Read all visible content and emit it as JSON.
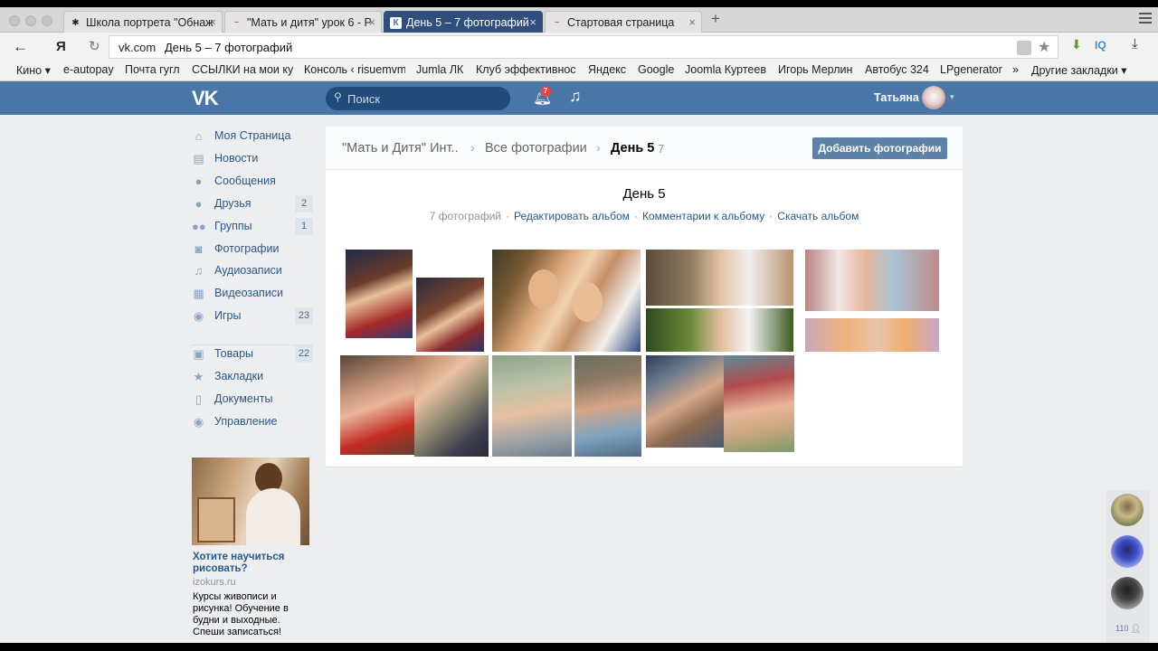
{
  "browser": {
    "tabs": [
      {
        "title": "Школа портрета \"Обнаж",
        "active": false
      },
      {
        "title": "\"Мать и дитя\" урок 6 - Р",
        "active": false
      },
      {
        "title": "День 5 – 7 фотографий",
        "active": true
      },
      {
        "title": "Стартовая страница",
        "active": false
      }
    ],
    "address": {
      "host": "vk.com",
      "title": "День 5 – 7 фотографий"
    },
    "ext_iq": "IQ",
    "bookmarks": [
      "Кино",
      "e-autopay",
      "Почта гугл",
      "ССЫЛКИ на мои ку",
      "Консоль ‹ risuemvm",
      "Jumla ЛК",
      "Клуб эффективнос",
      "Яндекс",
      "Google",
      "Joomla Куртеев",
      "Игорь Мерлин",
      "Автобус 324",
      "LPgenerator",
      "»",
      "Другие закладки"
    ]
  },
  "vk": {
    "logo": "VK",
    "search_placeholder": "Поиск",
    "notif_count": "7",
    "user_name": "Татьяна"
  },
  "sidebar": {
    "items": [
      {
        "label": "Моя Страница",
        "icon": "home-icon",
        "count": ""
      },
      {
        "label": "Новости",
        "icon": "news-icon",
        "count": ""
      },
      {
        "label": "Сообщения",
        "icon": "messages-icon",
        "count": ""
      },
      {
        "label": "Друзья",
        "icon": "friends-icon",
        "count": "2"
      },
      {
        "label": "Группы",
        "icon": "groups-icon",
        "count": "1"
      },
      {
        "label": "Фотографии",
        "icon": "camera-icon",
        "count": ""
      },
      {
        "label": "Аудиозаписи",
        "icon": "music-icon",
        "count": ""
      },
      {
        "label": "Видеозаписи",
        "icon": "video-icon",
        "count": ""
      },
      {
        "label": "Игры",
        "icon": "games-icon",
        "count": "23"
      },
      {
        "label": "Товары",
        "icon": "market-icon",
        "count": "22"
      },
      {
        "label": "Закладки",
        "icon": "star-icon",
        "count": ""
      },
      {
        "label": "Документы",
        "icon": "document-icon",
        "count": ""
      },
      {
        "label": "Управление",
        "icon": "gamepad-icon",
        "count": ""
      }
    ]
  },
  "ad": {
    "title": "Хотите научиться рисовать?",
    "domain": "izokurs.ru",
    "text": "Курсы живописи и рисунка! Обучение в будни и выходные. Спеши записаться!"
  },
  "album": {
    "crumbs": [
      "\"Мать и Дитя\" Инт..",
      "Все фотографии"
    ],
    "current": "День 5",
    "count": "7",
    "add_button": "Добавить фотографии",
    "title": "День 5",
    "photo_count_text": "7 фотографий",
    "actions": [
      "Редактировать альбом",
      "Комментарии к альбому",
      "Скачать альбом"
    ]
  },
  "chat": {
    "online_count": "110"
  }
}
